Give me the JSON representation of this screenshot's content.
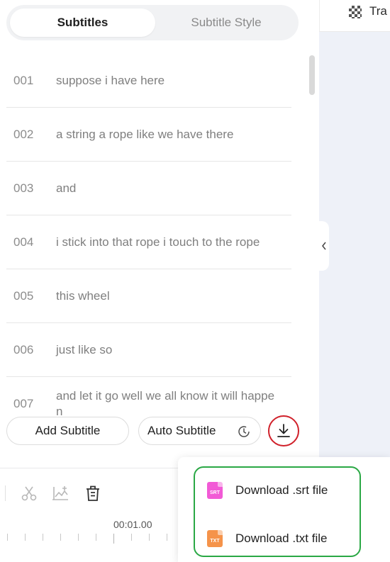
{
  "tabs": {
    "subtitles": "Subtitles",
    "subtitle_style": "Subtitle Style"
  },
  "subtitles": [
    {
      "num": "001",
      "text": "suppose i have here"
    },
    {
      "num": "002",
      "text": "a string a rope like we have there"
    },
    {
      "num": "003",
      "text": "and"
    },
    {
      "num": "004",
      "text": "i stick into that rope i touch to the rope"
    },
    {
      "num": "005",
      "text": "this wheel"
    },
    {
      "num": "006",
      "text": "just like so"
    },
    {
      "num": "007",
      "text": "and let it go well we all know it will happen"
    }
  ],
  "actions": {
    "add_subtitle": "Add Subtitle",
    "auto_subtitle": "Auto Subtitle"
  },
  "topbar": {
    "label": "Tra"
  },
  "timeline": {
    "time_label": "00:01.00"
  },
  "download_menu": {
    "srt": {
      "label": "Download .srt file",
      "badge": "SRT"
    },
    "txt": {
      "label": "Download .txt file",
      "badge": "TXT"
    }
  },
  "colors": {
    "download_highlight": "#d0202a",
    "menu_highlight": "#2aa845",
    "srt_icon": "#f25ad6",
    "txt_icon": "#f5934a"
  }
}
